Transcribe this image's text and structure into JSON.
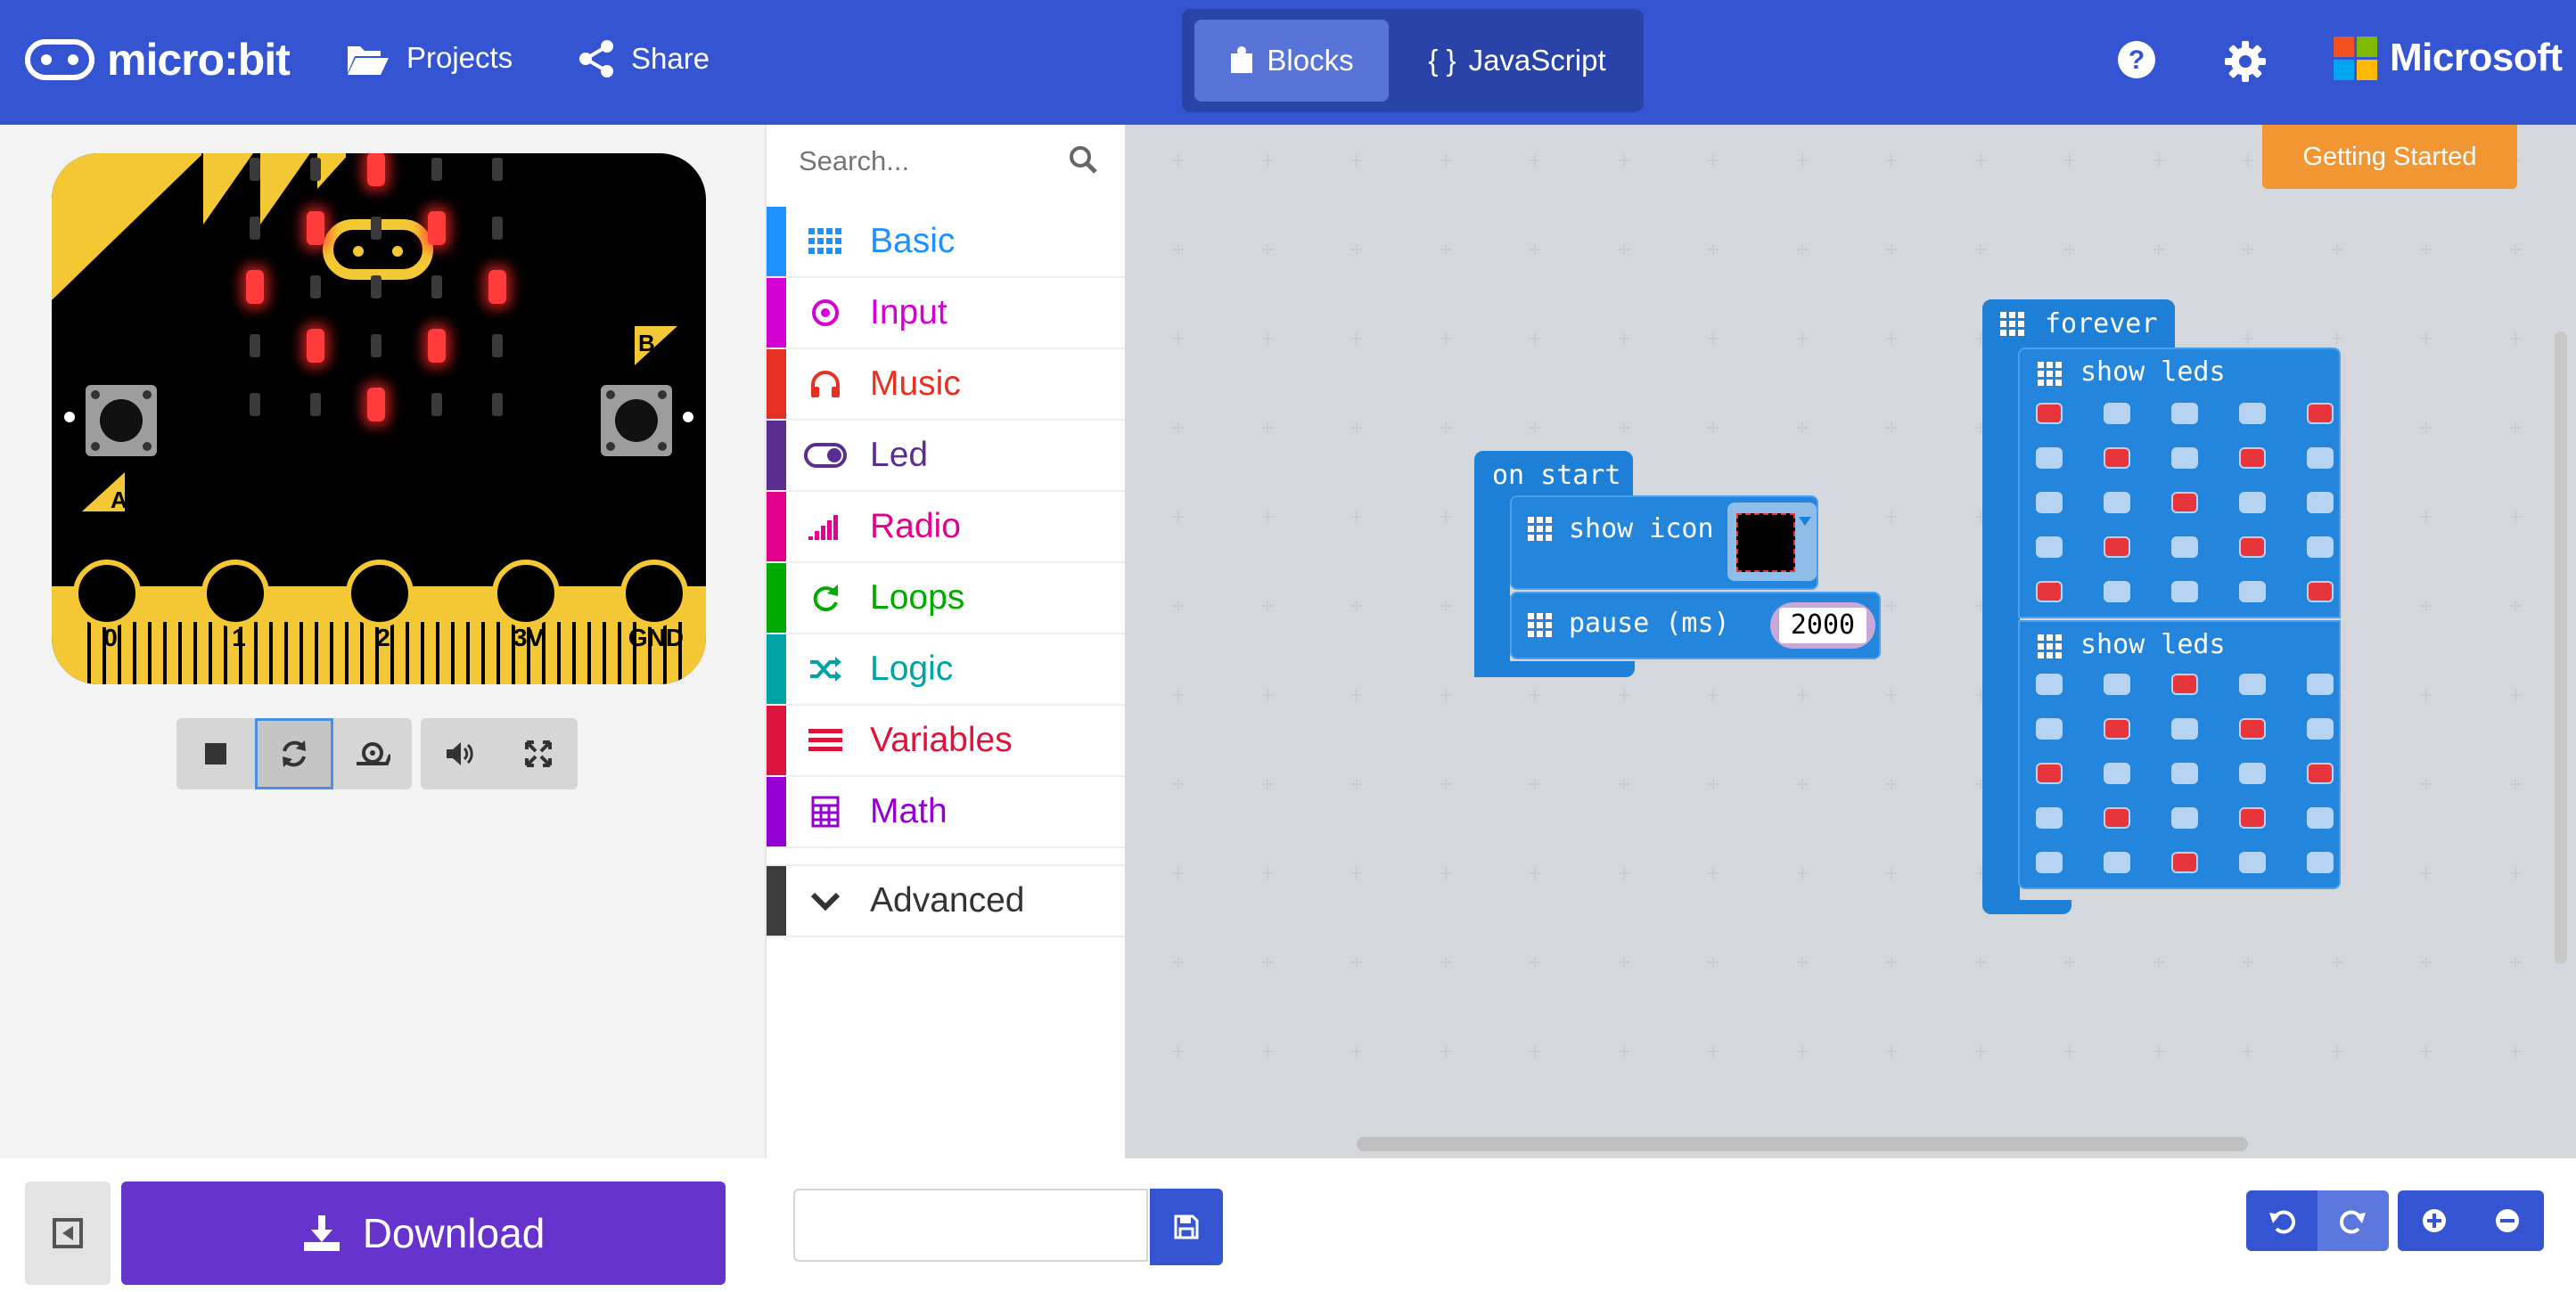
{
  "app": {
    "brand": "micro:bit",
    "nav": {
      "projects": "Projects",
      "share": "Share"
    },
    "modes": {
      "blocks": "Blocks",
      "javascript": "JavaScript",
      "javascript_icon": "{ }"
    },
    "vendor": "Microsoft",
    "colors": {
      "topbar": "#3454d1",
      "download": "#6633cc",
      "getting_started": "#f29633"
    }
  },
  "simulator": {
    "pins": [
      "0",
      "1",
      "2",
      "3V",
      "GND"
    ],
    "buttons": {
      "a": "A",
      "b": "B"
    },
    "led_matrix": [
      [
        0,
        0,
        1,
        0,
        0
      ],
      [
        0,
        1,
        0,
        1,
        0
      ],
      [
        1,
        0,
        0,
        0,
        1
      ],
      [
        0,
        1,
        0,
        1,
        0
      ],
      [
        0,
        0,
        1,
        0,
        0
      ]
    ],
    "controls": [
      "stop-icon",
      "restart-icon",
      "slow-mo-icon",
      "volume-icon",
      "fullscreen-icon"
    ]
  },
  "toolbox": {
    "search_placeholder": "Search...",
    "categories": [
      {
        "label": "Basic",
        "color": "#1e90ff",
        "icon": "grid-icon"
      },
      {
        "label": "Input",
        "color": "#d400d4",
        "icon": "target-icon"
      },
      {
        "label": "Music",
        "color": "#e63022",
        "icon": "headphones-icon"
      },
      {
        "label": "Led",
        "color": "#5c2d91",
        "icon": "toggle-icon"
      },
      {
        "label": "Radio",
        "color": "#e3008c",
        "icon": "signal-bars-icon"
      },
      {
        "label": "Loops",
        "color": "#00aa00",
        "icon": "refresh-icon"
      },
      {
        "label": "Logic",
        "color": "#00a4a6",
        "icon": "shuffle-icon"
      },
      {
        "label": "Variables",
        "color": "#dc143c",
        "icon": "list-icon"
      },
      {
        "label": "Math",
        "color": "#9400d3",
        "icon": "calculator-icon"
      }
    ],
    "advanced": "Advanced"
  },
  "workspace": {
    "getting_started": "Getting Started",
    "on_start": {
      "hat": "on start",
      "show_icon": "show icon",
      "pause": "pause (ms)",
      "pause_value": "2000"
    },
    "forever": {
      "hat": "forever",
      "show_leds_1": "show leds",
      "show_leds_2": "show leds",
      "leds_1": [
        [
          1,
          0,
          0,
          0,
          1
        ],
        [
          0,
          1,
          0,
          1,
          0
        ],
        [
          0,
          0,
          1,
          0,
          0
        ],
        [
          0,
          1,
          0,
          1,
          0
        ],
        [
          1,
          0,
          0,
          0,
          1
        ]
      ],
      "leds_2": [
        [
          0,
          0,
          1,
          0,
          0
        ],
        [
          0,
          1,
          0,
          1,
          0
        ],
        [
          1,
          0,
          0,
          0,
          1
        ],
        [
          0,
          1,
          0,
          1,
          0
        ],
        [
          0,
          0,
          1,
          0,
          0
        ]
      ]
    }
  },
  "bottom": {
    "download": "Download",
    "project_name": "",
    "project_placeholder": ""
  }
}
